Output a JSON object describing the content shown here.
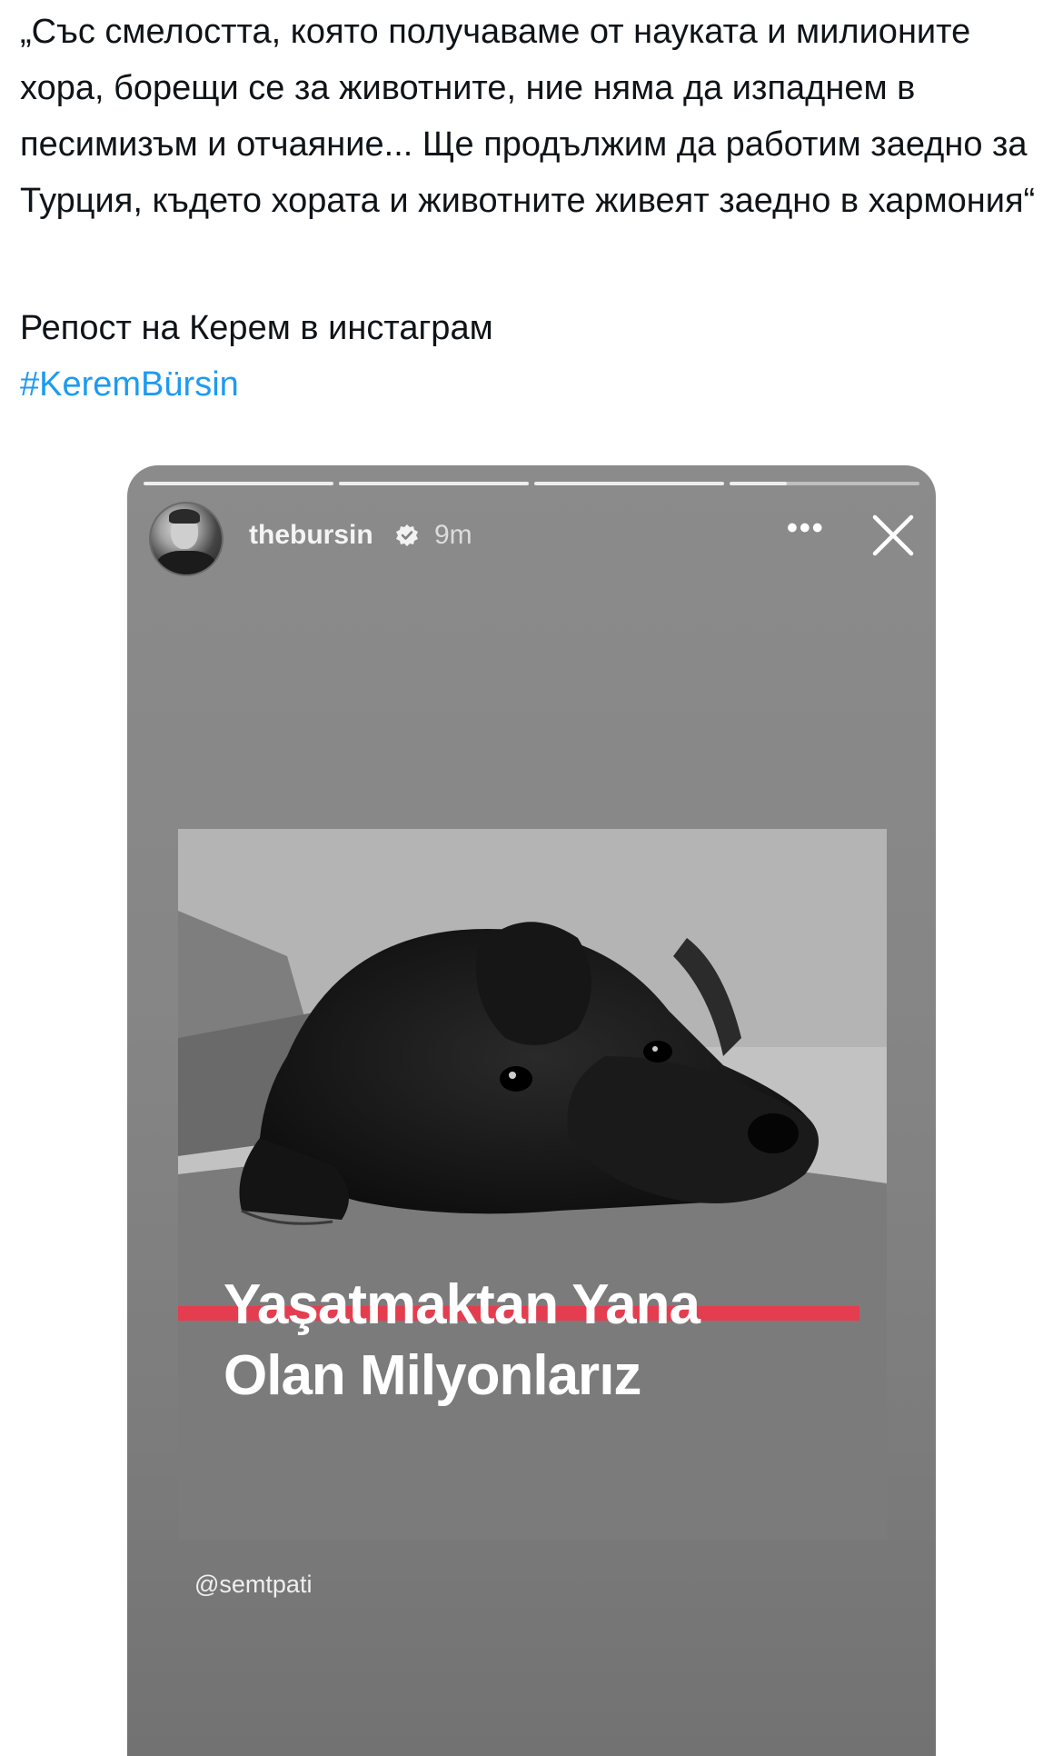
{
  "tweet": {
    "quote": "„Със смелостта, която получаваме от науката и милионите хора, борещи се за животните, ние няма да изпаднем в песимизъм и отчаяние... Ще продължим да работим заедно за Турция, където хората и животните живеят заедно в хармония“",
    "repost_note": "Репост на Керем в инстаграм",
    "hashtag": "#KeremBürsin",
    "colors": {
      "text": "#0f1419",
      "link": "#1d9bf0"
    }
  },
  "story": {
    "progress_segments": [
      1,
      1,
      1,
      0.3
    ],
    "username": "thebursin",
    "verified": true,
    "time": "9m",
    "more_icon": "more-horizontal-icon",
    "close_icon": "close-icon",
    "image": {
      "caption_line1": "Yaşatmaktan Yana",
      "caption_line2": "Olan Milyonlarız",
      "accent_color": "#e43d4f"
    },
    "credit": "@semtpati"
  }
}
